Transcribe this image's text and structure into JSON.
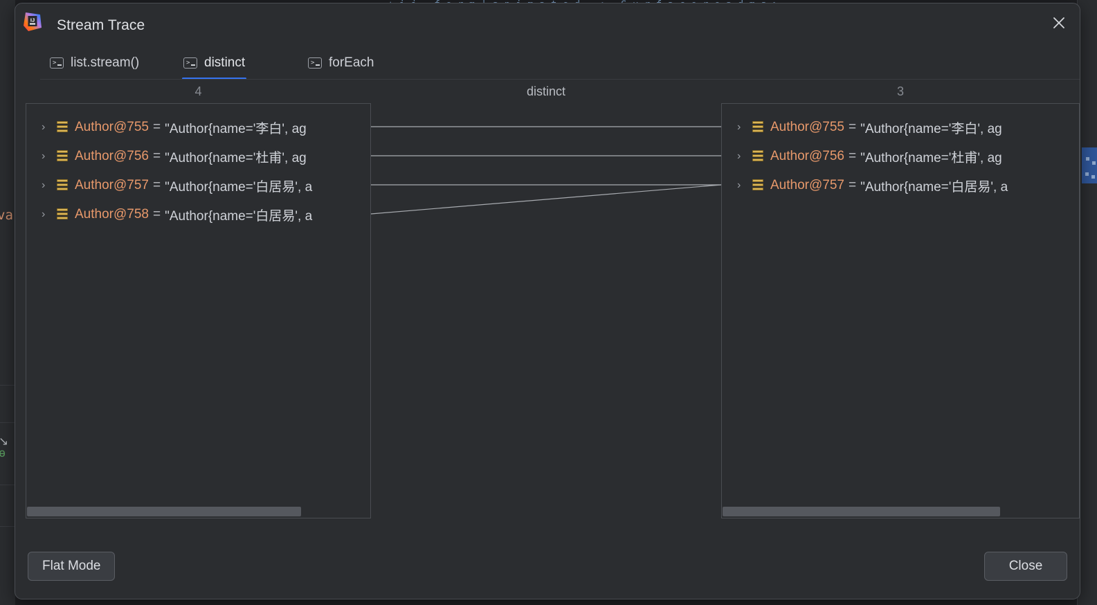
{
  "background": {
    "code_strip": "+ i j . f o r m |   a n i m a t e d   _ < .  S u r f a c e   r e a d   m a p . t h a t   + c a",
    "left_fragment_word": "va",
    "left_fragment_arrow": "↘",
    "left_fragment_bracket": "ɵ"
  },
  "dialog": {
    "title": "Stream Trace",
    "logo_name": "intellij-idea-logo",
    "close_icon": "close-icon"
  },
  "tabs": [
    {
      "label": "list.stream()",
      "icon": "terminal-icon",
      "active": false
    },
    {
      "label": "distinct",
      "icon": "terminal-icon",
      "active": true
    },
    {
      "label": "forEach",
      "icon": "terminal-icon",
      "active": false
    }
  ],
  "columns": {
    "left_count": "4",
    "operation": "distinct",
    "right_count": "3"
  },
  "left_panel": {
    "rows": [
      {
        "chevron": "›",
        "icon": "object-icon",
        "name": "Author@755",
        "eq": "=",
        "value": "\"Author{name='李白', ag"
      },
      {
        "chevron": "›",
        "icon": "object-icon",
        "name": "Author@756",
        "eq": "=",
        "value": "\"Author{name='杜甫', ag"
      },
      {
        "chevron": "›",
        "icon": "object-icon",
        "name": "Author@757",
        "eq": "=",
        "value": "\"Author{name='白居易', a"
      },
      {
        "chevron": "›",
        "icon": "object-icon",
        "name": "Author@758",
        "eq": "=",
        "value": "\"Author{name='白居易', a"
      }
    ],
    "scroll_thumb_percent": 80
  },
  "right_panel": {
    "rows": [
      {
        "chevron": "›",
        "icon": "object-icon",
        "name": "Author@755",
        "eq": "=",
        "value": "\"Author{name='李白', ag"
      },
      {
        "chevron": "›",
        "icon": "object-icon",
        "name": "Author@756",
        "eq": "=",
        "value": "\"Author{name='杜甫', ag"
      },
      {
        "chevron": "›",
        "icon": "object-icon",
        "name": "Author@757",
        "eq": "=",
        "value": "\"Author{name='白居易', a"
      }
    ],
    "scroll_thumb_percent": 78
  },
  "connections": [
    {
      "from_row": 0,
      "to_row": 0
    },
    {
      "from_row": 1,
      "to_row": 1
    },
    {
      "from_row": 2,
      "to_row": 2
    },
    {
      "from_row": 3,
      "to_row": 2
    }
  ],
  "footer": {
    "flat_mode_label": "Flat Mode",
    "close_label": "Close"
  },
  "colors": {
    "accent_blue": "#3574f0",
    "dialog_bg": "#2b2d30",
    "panel_border": "#4a4d52",
    "value_name": "#e8996b",
    "value_string": "#cfd2d8",
    "object_icon": "#d9b55b",
    "muted_text": "#868a91",
    "connector_line": "#a8abb0",
    "selection_blue": "#2f5699"
  }
}
